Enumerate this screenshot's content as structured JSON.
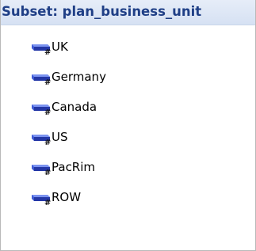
{
  "subset": {
    "title": "Subset: plan_business_unit",
    "icon": "consolidated-element-icon",
    "items": [
      {
        "label": "UK"
      },
      {
        "label": "Germany"
      },
      {
        "label": "Canada"
      },
      {
        "label": "US"
      },
      {
        "label": "PacRim"
      },
      {
        "label": "ROW"
      }
    ]
  }
}
